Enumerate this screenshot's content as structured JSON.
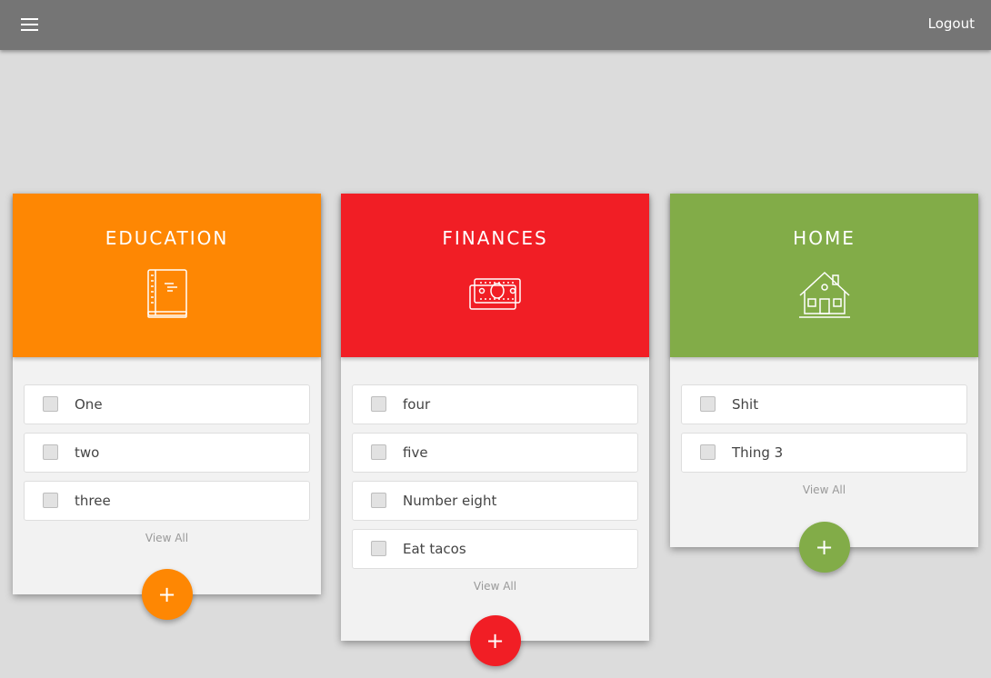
{
  "appbar": {
    "menu_icon": "hamburger-icon",
    "logout_label": "Logout"
  },
  "cards": [
    {
      "title": "EDUCATION",
      "icon": "book-icon",
      "color": "#fe8703",
      "todos": [
        "One",
        "two",
        "three"
      ],
      "view_all": "View All",
      "add_label": "+"
    },
    {
      "title": "FINANCES",
      "icon": "money-icon",
      "color": "#f11e25",
      "todos": [
        "four",
        "five",
        "Number eight",
        "Eat tacos"
      ],
      "view_all": "View All",
      "add_label": "+"
    },
    {
      "title": "HOME",
      "icon": "house-icon",
      "color": "#82ac48",
      "todos": [
        "Shit",
        "Thing 3"
      ],
      "view_all": "View All",
      "add_label": "+"
    }
  ]
}
